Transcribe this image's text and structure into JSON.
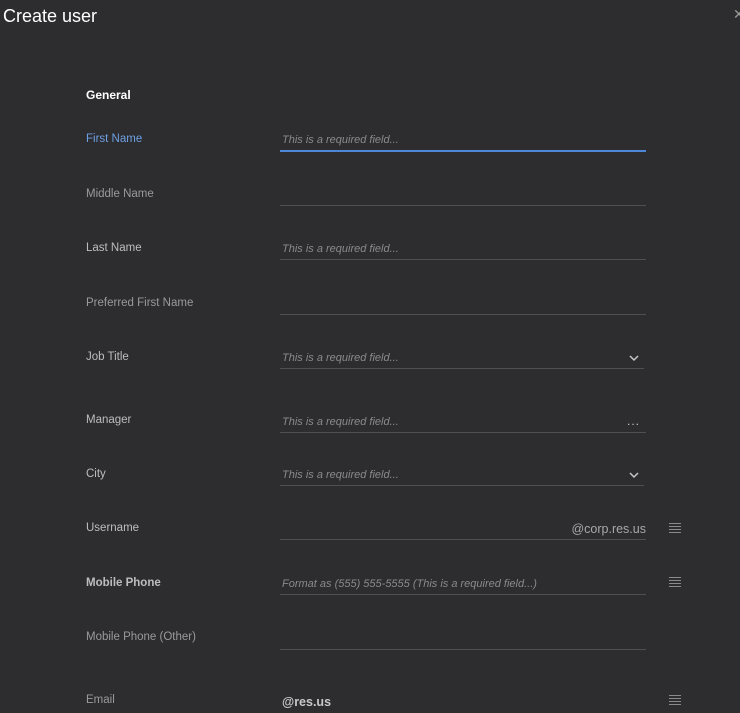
{
  "dialog": {
    "title": "Create user"
  },
  "section": {
    "general": "General"
  },
  "fields": {
    "first_name": {
      "label": "First Name",
      "placeholder": "This is a required field..."
    },
    "middle_name": {
      "label": "Middle Name",
      "placeholder": ""
    },
    "last_name": {
      "label": "Last Name",
      "placeholder": "This is a required field..."
    },
    "preferred_first_name": {
      "label": "Preferred First Name",
      "placeholder": ""
    },
    "job_title": {
      "label": "Job Title",
      "placeholder": "This is a required field...",
      "icon": "chevron-down-icon"
    },
    "manager": {
      "label": "Manager",
      "placeholder": "This is a required field...",
      "icon": "ellipsis-icon",
      "icon_text": "..."
    },
    "city": {
      "label": "City",
      "placeholder": "This is a required field...",
      "icon": "chevron-down-icon"
    },
    "username": {
      "label": "Username",
      "placeholder": "",
      "suffix": "@corp.res.us",
      "icon": "menu-icon"
    },
    "mobile_phone": {
      "label": "Mobile Phone",
      "placeholder": "Format as (555) 555-5555 (This is a required field...)",
      "icon": "menu-icon"
    },
    "mobile_phone_other": {
      "label": "Mobile Phone (Other)",
      "placeholder": ""
    },
    "email": {
      "label": "Email",
      "value": "@res.us",
      "icon": "menu-icon"
    }
  },
  "colors": {
    "background": "#2d2d30",
    "accent": "#4e86d8",
    "label_active": "#6d9fe3"
  }
}
